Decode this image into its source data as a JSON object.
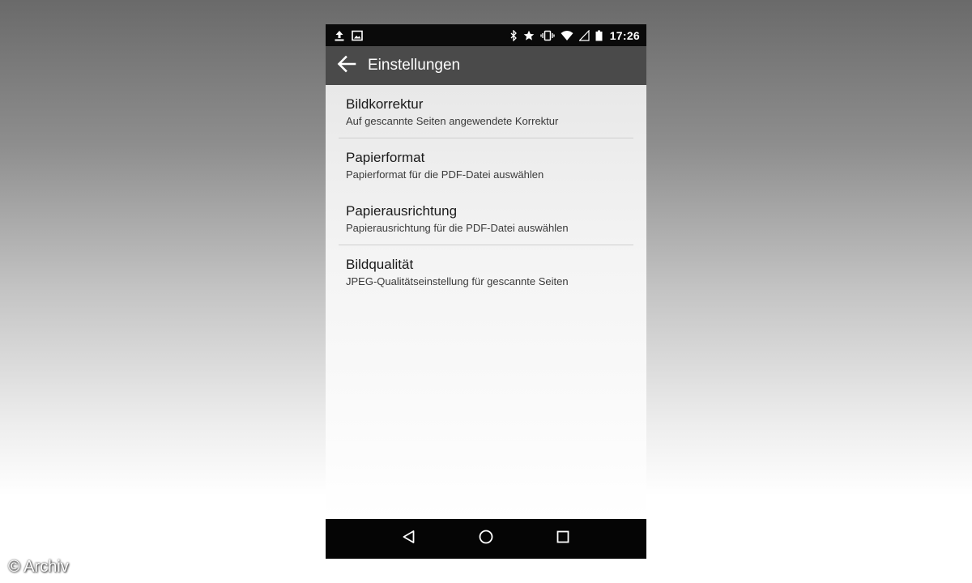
{
  "status_bar": {
    "time": "17:26",
    "left_icons": [
      "upload-icon",
      "image-icon"
    ],
    "right_icons": [
      "bluetooth-icon",
      "star-icon",
      "vibrate-icon",
      "wifi-icon",
      "signal-icon",
      "battery-icon"
    ]
  },
  "toolbar": {
    "back_icon": "arrow-left-icon",
    "title": "Einstellungen"
  },
  "settings": {
    "items": [
      {
        "title": "Bildkorrektur",
        "summary": "Auf gescannte Seiten angewendete Korrektur"
      },
      {
        "title": "Papierformat",
        "summary": "Papierformat für die PDF-Datei auswählen"
      },
      {
        "title": "Papierausrichtung",
        "summary": "Papierausrichtung für die PDF-Datei auswählen"
      },
      {
        "title": "Bildqualität",
        "summary": "JPEG-Qualitätseinstellung für gescannte Seiten"
      }
    ]
  },
  "nav_bar": {
    "icons": [
      "back-triangle-icon",
      "home-circle-icon",
      "recents-square-icon"
    ]
  },
  "watermark": "© Archiv",
  "colors": {
    "status_bar": "#0a0a0a",
    "toolbar": "#4a4a4a",
    "nav_bar": "#050505"
  }
}
